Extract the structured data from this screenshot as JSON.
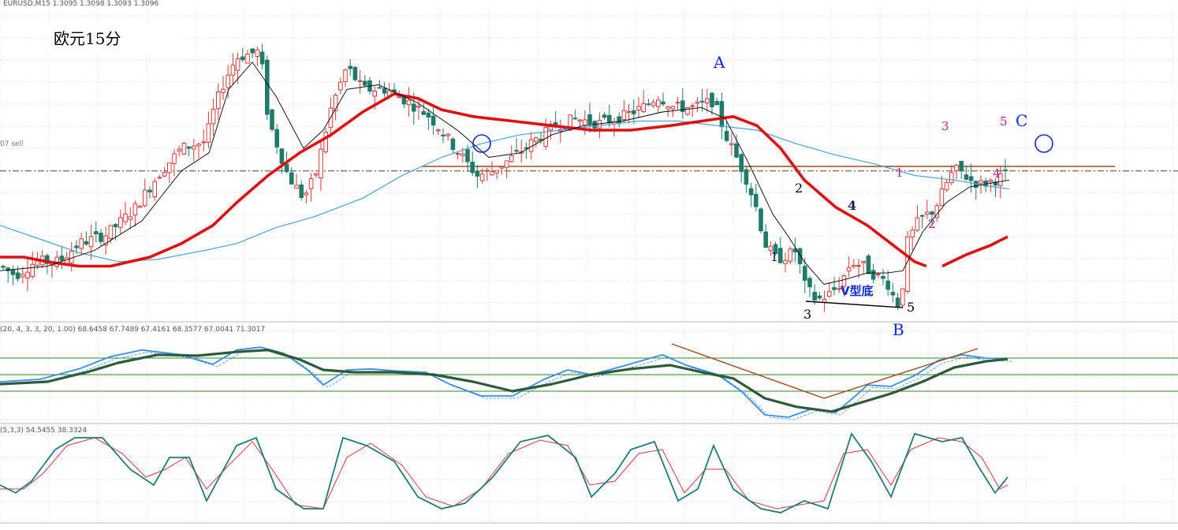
{
  "header": {
    "symbol_line": "EURUSD,M15  1.3095 1.3098 1.3093 1.3096",
    "price_tag": "07 sell",
    "indicator1_values": "(20, 4, 3, 3, 20, 1.00) 68.6458 67.7489 67.4161 68.3577 67.0041 71.3017",
    "indicator2_values": "(5,3,3) 54.5455 38.3324"
  },
  "title": "欧元15分",
  "labels": {
    "A": "A",
    "B": "B",
    "C": "C",
    "v_bottom": "V型底",
    "wave_down": [
      "1",
      "2",
      "3",
      "4",
      "5"
    ],
    "wave_up": [
      "1",
      "2",
      "3",
      "4",
      "5"
    ]
  },
  "colors": {
    "grid": "#d8d8d8",
    "bull_candle": "#d23b3b",
    "bear_candle": "#1f7a6a",
    "thin_ma": "#000000",
    "red_ma": "#e01010",
    "blue_ma": "#4aa3d8",
    "resistance": "#a04a1a",
    "circle": "#0a2bd8",
    "wave_magenta": "#c8188a",
    "wave_navy": "#0a1a6a",
    "osc_blue": "#3a8ee8",
    "osc_dark": "#2e5a3a",
    "stoch_teal": "#1f7a7a",
    "stoch_red": "#d23b3b",
    "level_green": "#2a8a2a"
  },
  "chart_data": [
    {
      "type": "candlestick",
      "title": "欧元15分",
      "trend_path_y": [
        [
          0,
          0.2
        ],
        [
          20,
          0.16
        ],
        [
          45,
          0.22
        ],
        [
          75,
          0.22
        ],
        [
          100,
          0.3
        ],
        [
          135,
          0.34
        ],
        [
          170,
          0.45
        ],
        [
          200,
          0.6
        ],
        [
          230,
          0.72
        ],
        [
          260,
          0.75
        ],
        [
          272,
          0.9
        ],
        [
          285,
          1.02
        ],
        [
          300,
          1.12
        ],
        [
          330,
          1.15
        ],
        [
          340,
          0.85
        ],
        [
          365,
          0.6
        ],
        [
          385,
          0.5
        ],
        [
          400,
          0.6
        ],
        [
          420,
          0.9
        ],
        [
          440,
          1.08
        ],
        [
          460,
          0.98
        ],
        [
          490,
          0.98
        ],
        [
          520,
          0.92
        ],
        [
          545,
          0.86
        ],
        [
          575,
          0.73
        ],
        [
          605,
          0.6
        ],
        [
          625,
          0.62
        ],
        [
          650,
          0.68
        ],
        [
          680,
          0.76
        ],
        [
          705,
          0.82
        ],
        [
          730,
          0.85
        ],
        [
          760,
          0.83
        ],
        [
          790,
          0.86
        ],
        [
          815,
          0.9
        ],
        [
          835,
          0.95
        ],
        [
          855,
          0.9
        ],
        [
          880,
          0.9
        ],
        [
          905,
          0.93
        ],
        [
          920,
          0.78
        ],
        [
          945,
          0.6
        ],
        [
          960,
          0.45
        ],
        [
          970,
          0.3
        ],
        [
          985,
          0.23
        ],
        [
          1000,
          0.25
        ],
        [
          1010,
          0.27
        ],
        [
          1020,
          0.12
        ],
        [
          1035,
          0.05
        ],
        [
          1050,
          0.07
        ],
        [
          1065,
          0.12
        ],
        [
          1080,
          0.22
        ],
        [
          1095,
          0.2
        ],
        [
          1110,
          0.16
        ],
        [
          1125,
          0.13
        ],
        [
          1135,
          0.05
        ],
        [
          1142,
          0.02
        ],
        [
          1150,
          0.3
        ],
        [
          1165,
          0.4
        ],
        [
          1185,
          0.45
        ],
        [
          1205,
          0.6
        ],
        [
          1215,
          0.63
        ],
        [
          1230,
          0.58
        ],
        [
          1245,
          0.56
        ],
        [
          1262,
          0.58
        ],
        [
          1280,
          0.61
        ]
      ],
      "thin_ma_y": [
        [
          0,
          0.18
        ],
        [
          60,
          0.2
        ],
        [
          120,
          0.27
        ],
        [
          180,
          0.4
        ],
        [
          230,
          0.62
        ],
        [
          265,
          0.7
        ],
        [
          290,
          0.98
        ],
        [
          320,
          1.1
        ],
        [
          350,
          0.95
        ],
        [
          385,
          0.72
        ],
        [
          410,
          0.8
        ],
        [
          440,
          0.98
        ],
        [
          480,
          1.0
        ],
        [
          530,
          0.92
        ],
        [
          580,
          0.8
        ],
        [
          620,
          0.68
        ],
        [
          660,
          0.7
        ],
        [
          700,
          0.78
        ],
        [
          740,
          0.82
        ],
        [
          790,
          0.84
        ],
        [
          840,
          0.88
        ],
        [
          890,
          0.9
        ],
        [
          920,
          0.85
        ],
        [
          950,
          0.65
        ],
        [
          980,
          0.43
        ],
        [
          1000,
          0.33
        ],
        [
          1020,
          0.22
        ],
        [
          1045,
          0.12
        ],
        [
          1070,
          0.14
        ],
        [
          1100,
          0.17
        ],
        [
          1125,
          0.17
        ],
        [
          1145,
          0.18
        ],
        [
          1170,
          0.35
        ],
        [
          1200,
          0.48
        ],
        [
          1230,
          0.55
        ],
        [
          1280,
          0.58
        ]
      ],
      "red_ma_y": [
        [
          0,
          0.24
        ],
        [
          30,
          0.24
        ],
        [
          60,
          0.22
        ],
        [
          100,
          0.2
        ],
        [
          140,
          0.2
        ],
        [
          190,
          0.24
        ],
        [
          230,
          0.3
        ],
        [
          270,
          0.38
        ],
        [
          300,
          0.48
        ],
        [
          340,
          0.6
        ],
        [
          380,
          0.7
        ],
        [
          420,
          0.78
        ],
        [
          460,
          0.88
        ],
        [
          500,
          0.96
        ],
        [
          530,
          0.94
        ],
        [
          560,
          0.89
        ],
        [
          600,
          0.86
        ],
        [
          650,
          0.84
        ],
        [
          700,
          0.82
        ],
        [
          750,
          0.8
        ],
        [
          800,
          0.8
        ],
        [
          850,
          0.82
        ],
        [
          890,
          0.84
        ],
        [
          930,
          0.86
        ],
        [
          960,
          0.82
        ],
        [
          990,
          0.72
        ],
        [
          1020,
          0.58
        ],
        [
          1060,
          0.46
        ],
        [
          1100,
          0.38
        ],
        [
          1130,
          0.3
        ],
        [
          1160,
          0.22
        ],
        [
          1175,
          0.2
        ]
      ],
      "red_ma_tail_y": [
        [
          1195,
          0.2
        ],
        [
          1225,
          0.25
        ],
        [
          1255,
          0.29
        ],
        [
          1278,
          0.33
        ]
      ],
      "blue_ma_y": [
        [
          0,
          0.38
        ],
        [
          50,
          0.32
        ],
        [
          100,
          0.26
        ],
        [
          150,
          0.22
        ],
        [
          200,
          0.23
        ],
        [
          260,
          0.27
        ],
        [
          300,
          0.3
        ],
        [
          350,
          0.37
        ],
        [
          400,
          0.42
        ],
        [
          460,
          0.5
        ],
        [
          510,
          0.6
        ],
        [
          560,
          0.68
        ],
        [
          610,
          0.74
        ],
        [
          660,
          0.78
        ],
        [
          710,
          0.8
        ],
        [
          760,
          0.82
        ],
        [
          810,
          0.84
        ],
        [
          860,
          0.84
        ],
        [
          910,
          0.82
        ],
        [
          960,
          0.8
        ],
        [
          1010,
          0.74
        ],
        [
          1060,
          0.69
        ],
        [
          1110,
          0.65
        ],
        [
          1160,
          0.6
        ],
        [
          1210,
          0.58
        ],
        [
          1260,
          0.55
        ],
        [
          1280,
          0.54
        ]
      ],
      "resistance_level": 0.64,
      "dashdot_level": 0.62,
      "y_range": [
        0,
        1.2
      ]
    },
    {
      "type": "line",
      "name": "oscillator",
      "levels": [
        0.85,
        0.5,
        0.15
      ],
      "fast_y": [
        [
          0,
          0.35
        ],
        [
          50,
          0.4
        ],
        [
          100,
          0.62
        ],
        [
          140,
          0.88
        ],
        [
          180,
          1.02
        ],
        [
          230,
          0.92
        ],
        [
          270,
          0.72
        ],
        [
          300,
          1.02
        ],
        [
          330,
          1.08
        ],
        [
          360,
          0.95
        ],
        [
          390,
          0.6
        ],
        [
          410,
          0.28
        ],
        [
          440,
          0.6
        ],
        [
          470,
          0.62
        ],
        [
          500,
          0.58
        ],
        [
          540,
          0.55
        ],
        [
          570,
          0.3
        ],
        [
          610,
          0.05
        ],
        [
          650,
          0.05
        ],
        [
          690,
          0.4
        ],
        [
          720,
          0.6
        ],
        [
          750,
          0.5
        ],
        [
          790,
          0.68
        ],
        [
          840,
          0.92
        ],
        [
          870,
          0.7
        ],
        [
          910,
          0.5
        ],
        [
          940,
          0.15
        ],
        [
          970,
          -0.35
        ],
        [
          1000,
          -0.4
        ],
        [
          1030,
          -0.22
        ],
        [
          1060,
          -0.3
        ],
        [
          1085,
          0.05
        ],
        [
          1100,
          0.28
        ],
        [
          1130,
          0.25
        ],
        [
          1160,
          0.48
        ],
        [
          1190,
          0.8
        ],
        [
          1220,
          0.92
        ],
        [
          1250,
          0.85
        ],
        [
          1278,
          0.83
        ]
      ],
      "slow_y": [
        [
          0,
          0.3
        ],
        [
          60,
          0.35
        ],
        [
          110,
          0.55
        ],
        [
          150,
          0.75
        ],
        [
          200,
          0.92
        ],
        [
          250,
          0.9
        ],
        [
          300,
          0.98
        ],
        [
          340,
          1.02
        ],
        [
          380,
          0.82
        ],
        [
          410,
          0.6
        ],
        [
          450,
          0.55
        ],
        [
          500,
          0.55
        ],
        [
          550,
          0.5
        ],
        [
          600,
          0.35
        ],
        [
          650,
          0.15
        ],
        [
          700,
          0.3
        ],
        [
          750,
          0.5
        ],
        [
          800,
          0.62
        ],
        [
          850,
          0.7
        ],
        [
          890,
          0.55
        ],
        [
          930,
          0.42
        ],
        [
          970,
          0.0
        ],
        [
          1010,
          -0.18
        ],
        [
          1055,
          -0.28
        ],
        [
          1090,
          -0.1
        ],
        [
          1130,
          0.1
        ],
        [
          1170,
          0.35
        ],
        [
          1210,
          0.65
        ],
        [
          1250,
          0.78
        ],
        [
          1278,
          0.83
        ]
      ],
      "divergence_line_y": [
        [
          852,
          1.15
        ],
        [
          1045,
          0.0
        ],
        [
          1240,
          1.05
        ]
      ]
    },
    {
      "type": "line",
      "name": "stochastic",
      "k_y": [
        [
          0,
          0.35
        ],
        [
          20,
          0.25
        ],
        [
          40,
          0.4
        ],
        [
          70,
          0.8
        ],
        [
          95,
          0.95
        ],
        [
          130,
          0.95
        ],
        [
          165,
          0.55
        ],
        [
          195,
          0.35
        ],
        [
          215,
          0.7
        ],
        [
          240,
          0.7
        ],
        [
          262,
          0.15
        ],
        [
          300,
          0.85
        ],
        [
          325,
          0.95
        ],
        [
          350,
          0.3
        ],
        [
          385,
          0.05
        ],
        [
          410,
          0.05
        ],
        [
          435,
          0.95
        ],
        [
          465,
          0.85
        ],
        [
          500,
          0.65
        ],
        [
          530,
          0.2
        ],
        [
          560,
          0.05
        ],
        [
          590,
          0.12
        ],
        [
          625,
          0.45
        ],
        [
          660,
          0.9
        ],
        [
          695,
          0.98
        ],
        [
          730,
          0.7
        ],
        [
          750,
          0.2
        ],
        [
          780,
          0.5
        ],
        [
          800,
          0.8
        ],
        [
          830,
          0.9
        ],
        [
          860,
          0.15
        ],
        [
          885,
          0.3
        ],
        [
          905,
          0.85
        ],
        [
          930,
          0.3
        ],
        [
          965,
          0.05
        ],
        [
          990,
          0.0
        ],
        [
          1020,
          0.15
        ],
        [
          1050,
          0.05
        ],
        [
          1080,
          1.0
        ],
        [
          1105,
          0.65
        ],
        [
          1130,
          0.2
        ],
        [
          1160,
          1.0
        ],
        [
          1195,
          0.9
        ],
        [
          1220,
          0.95
        ],
        [
          1240,
          0.6
        ],
        [
          1262,
          0.25
        ],
        [
          1278,
          0.45
        ]
      ],
      "d_y": [
        [
          0,
          0.3
        ],
        [
          30,
          0.3
        ],
        [
          55,
          0.5
        ],
        [
          85,
          0.85
        ],
        [
          120,
          0.95
        ],
        [
          155,
          0.75
        ],
        [
          185,
          0.45
        ],
        [
          210,
          0.55
        ],
        [
          235,
          0.7
        ],
        [
          262,
          0.3
        ],
        [
          290,
          0.6
        ],
        [
          320,
          0.9
        ],
        [
          345,
          0.55
        ],
        [
          375,
          0.1
        ],
        [
          410,
          0.05
        ],
        [
          440,
          0.7
        ],
        [
          470,
          0.88
        ],
        [
          510,
          0.6
        ],
        [
          540,
          0.2
        ],
        [
          575,
          0.08
        ],
        [
          610,
          0.3
        ],
        [
          645,
          0.75
        ],
        [
          685,
          0.92
        ],
        [
          720,
          0.85
        ],
        [
          748,
          0.35
        ],
        [
          780,
          0.4
        ],
        [
          810,
          0.75
        ],
        [
          840,
          0.8
        ],
        [
          868,
          0.25
        ],
        [
          895,
          0.55
        ],
        [
          920,
          0.55
        ],
        [
          950,
          0.15
        ],
        [
          985,
          0.05
        ],
        [
          1015,
          0.1
        ],
        [
          1045,
          0.15
        ],
        [
          1070,
          0.75
        ],
        [
          1100,
          0.8
        ],
        [
          1130,
          0.35
        ],
        [
          1155,
          0.8
        ],
        [
          1190,
          0.95
        ],
        [
          1220,
          0.9
        ],
        [
          1245,
          0.7
        ],
        [
          1268,
          0.3
        ],
        [
          1278,
          0.35
        ]
      ]
    }
  ]
}
